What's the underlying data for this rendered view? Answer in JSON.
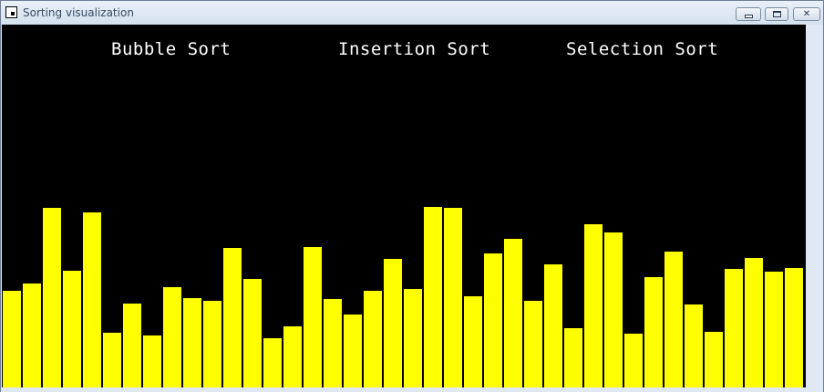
{
  "window": {
    "title": "Sorting visualization",
    "minimize_glyph": "",
    "maximize_glyph": "",
    "close_glyph": "✕"
  },
  "algorithms": {
    "bubble": "Bubble Sort",
    "insertion": "Insertion Sort",
    "selection": "Selection Sort"
  },
  "bars": {
    "color": "#ffff00",
    "background": "#000000",
    "max_value": 398,
    "values": [
      106,
      114,
      197,
      128,
      192,
      60,
      92,
      57,
      110,
      98,
      95,
      153,
      119,
      54,
      67,
      154,
      97,
      80,
      106,
      141,
      108,
      198,
      197,
      100,
      147,
      163,
      95,
      135,
      65,
      179,
      170,
      59,
      121,
      149,
      91,
      61,
      130,
      142,
      127,
      131
    ]
  }
}
